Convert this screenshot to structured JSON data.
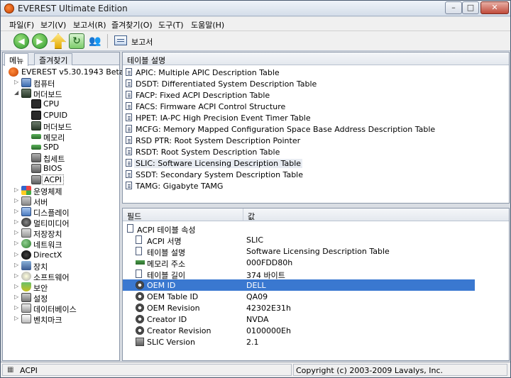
{
  "window": {
    "title": "EVEREST Ultimate Edition",
    "min_glyph": "–",
    "max_glyph": "□",
    "close_glyph": "✕"
  },
  "menu": [
    "파일(F)",
    "보기(V)",
    "보고서(R)",
    "즐겨찾기(O)",
    "도구(T)",
    "도움말(H)"
  ],
  "toolbar": {
    "back_glyph": "◀",
    "forward_glyph": "▶",
    "refresh_glyph": "↻",
    "users_glyph": "👥",
    "report_label": "보고서"
  },
  "left_tabs": [
    "메뉴",
    "즐겨찾기"
  ],
  "tree": [
    {
      "label": "EVEREST v5.30.1943 Beta",
      "icon": "everest-logo-icon",
      "level": 0,
      "expander": ""
    },
    {
      "label": "컴퓨터",
      "icon": "computer-icon",
      "level": 1,
      "expander": "▷"
    },
    {
      "label": "머더보드",
      "icon": "motherboard-icon",
      "level": 1,
      "expander": "◢"
    },
    {
      "label": "CPU",
      "icon": "cpu-icon",
      "level": 2,
      "expander": ""
    },
    {
      "label": "CPUID",
      "icon": "cpu-icon",
      "level": 2,
      "expander": ""
    },
    {
      "label": "머더보드",
      "icon": "motherboard-icon",
      "level": 2,
      "expander": ""
    },
    {
      "label": "메모리",
      "icon": "memory-icon",
      "level": 2,
      "expander": ""
    },
    {
      "label": "SPD",
      "icon": "memory-icon",
      "level": 2,
      "expander": ""
    },
    {
      "label": "칩세트",
      "icon": "chipset-icon",
      "level": 2,
      "expander": ""
    },
    {
      "label": "BIOS",
      "icon": "chipset-icon",
      "level": 2,
      "expander": ""
    },
    {
      "label": "ACPI",
      "icon": "chipset-icon",
      "level": 2,
      "expander": "",
      "selected": true
    },
    {
      "label": "운영체제",
      "icon": "windows-icon",
      "level": 1,
      "expander": "▷"
    },
    {
      "label": "서버",
      "icon": "server-icon",
      "level": 1,
      "expander": "▷"
    },
    {
      "label": "디스플레이",
      "icon": "monitor-icon",
      "level": 1,
      "expander": "▷"
    },
    {
      "label": "멀티미디어",
      "icon": "speaker-icon",
      "level": 1,
      "expander": "▷"
    },
    {
      "label": "저장장치",
      "icon": "drive-icon",
      "level": 1,
      "expander": "▷"
    },
    {
      "label": "네트워크",
      "icon": "network-icon",
      "level": 1,
      "expander": "▷"
    },
    {
      "label": "DirectX",
      "icon": "directx-icon",
      "level": 1,
      "expander": "▷"
    },
    {
      "label": "장치",
      "icon": "device-icon",
      "level": 1,
      "expander": "▷"
    },
    {
      "label": "소프트웨어",
      "icon": "software-icon",
      "level": 1,
      "expander": "▷"
    },
    {
      "label": "보안",
      "icon": "shield-icon",
      "level": 1,
      "expander": "▷"
    },
    {
      "label": "설정",
      "icon": "settings-icon",
      "level": 1,
      "expander": "▷"
    },
    {
      "label": "데이터베이스",
      "icon": "database-icon",
      "level": 1,
      "expander": "▷"
    },
    {
      "label": "벤치마크",
      "icon": "benchmark-icon",
      "level": 1,
      "expander": "▷"
    }
  ],
  "table_list": {
    "header": "테이블 설명",
    "rows": [
      "APIC: Multiple APIC Description Table",
      "DSDT: Differentiated System Description Table",
      "FACP: Fixed ACPI Description Table",
      "FACS: Firmware ACPI Control Structure",
      "HPET: IA-PC High Precision Event Timer Table",
      "MCFG: Memory Mapped Configuration Space Base Address Description Table",
      "RSD PTR: Root System Description Pointer",
      "RSDT: Root System Description Table",
      "SLIC: Software Licensing Description Table",
      "SSDT: Secondary System Description Table",
      "TAMG: Gigabyte TAMG"
    ],
    "selected_index": 8
  },
  "properties": {
    "col_field": "필드",
    "col_value": "값",
    "rows": [
      {
        "field": "ACPI 테이블 속성",
        "value": "",
        "icon": "doc-icon",
        "indent": 0
      },
      {
        "field": "ACPI 서명",
        "value": "SLIC",
        "icon": "doc-icon",
        "indent": 1
      },
      {
        "field": "테이블 설명",
        "value": "Software Licensing Description Table",
        "icon": "doc-icon",
        "indent": 1
      },
      {
        "field": "메모리 주소",
        "value": "000FDD80h",
        "icon": "memory-icon",
        "indent": 1
      },
      {
        "field": "테이블 길이",
        "value": "374 바이트",
        "icon": "doc-icon",
        "indent": 1
      },
      {
        "field": "OEM ID",
        "value": "DELL",
        "icon": "gear-icon",
        "indent": 1,
        "highlight": true
      },
      {
        "field": "OEM Table ID",
        "value": "QA09",
        "icon": "gear-icon",
        "indent": 1
      },
      {
        "field": "OEM Revision",
        "value": "42302E31h",
        "icon": "gear-icon",
        "indent": 1
      },
      {
        "field": "Creator ID",
        "value": "NVDA",
        "icon": "gear-icon",
        "indent": 1
      },
      {
        "field": "Creator Revision",
        "value": "0100000Eh",
        "icon": "gear-icon",
        "indent": 1
      },
      {
        "field": "SLIC Version",
        "value": "2.1",
        "icon": "chipset-icon",
        "indent": 1
      }
    ]
  },
  "status": {
    "left": "ACPI",
    "right": "Copyright (c) 2003-2009 Lavalys, Inc."
  },
  "colors": {
    "selection": "#3a78d0",
    "title_accent": "#c44000"
  }
}
